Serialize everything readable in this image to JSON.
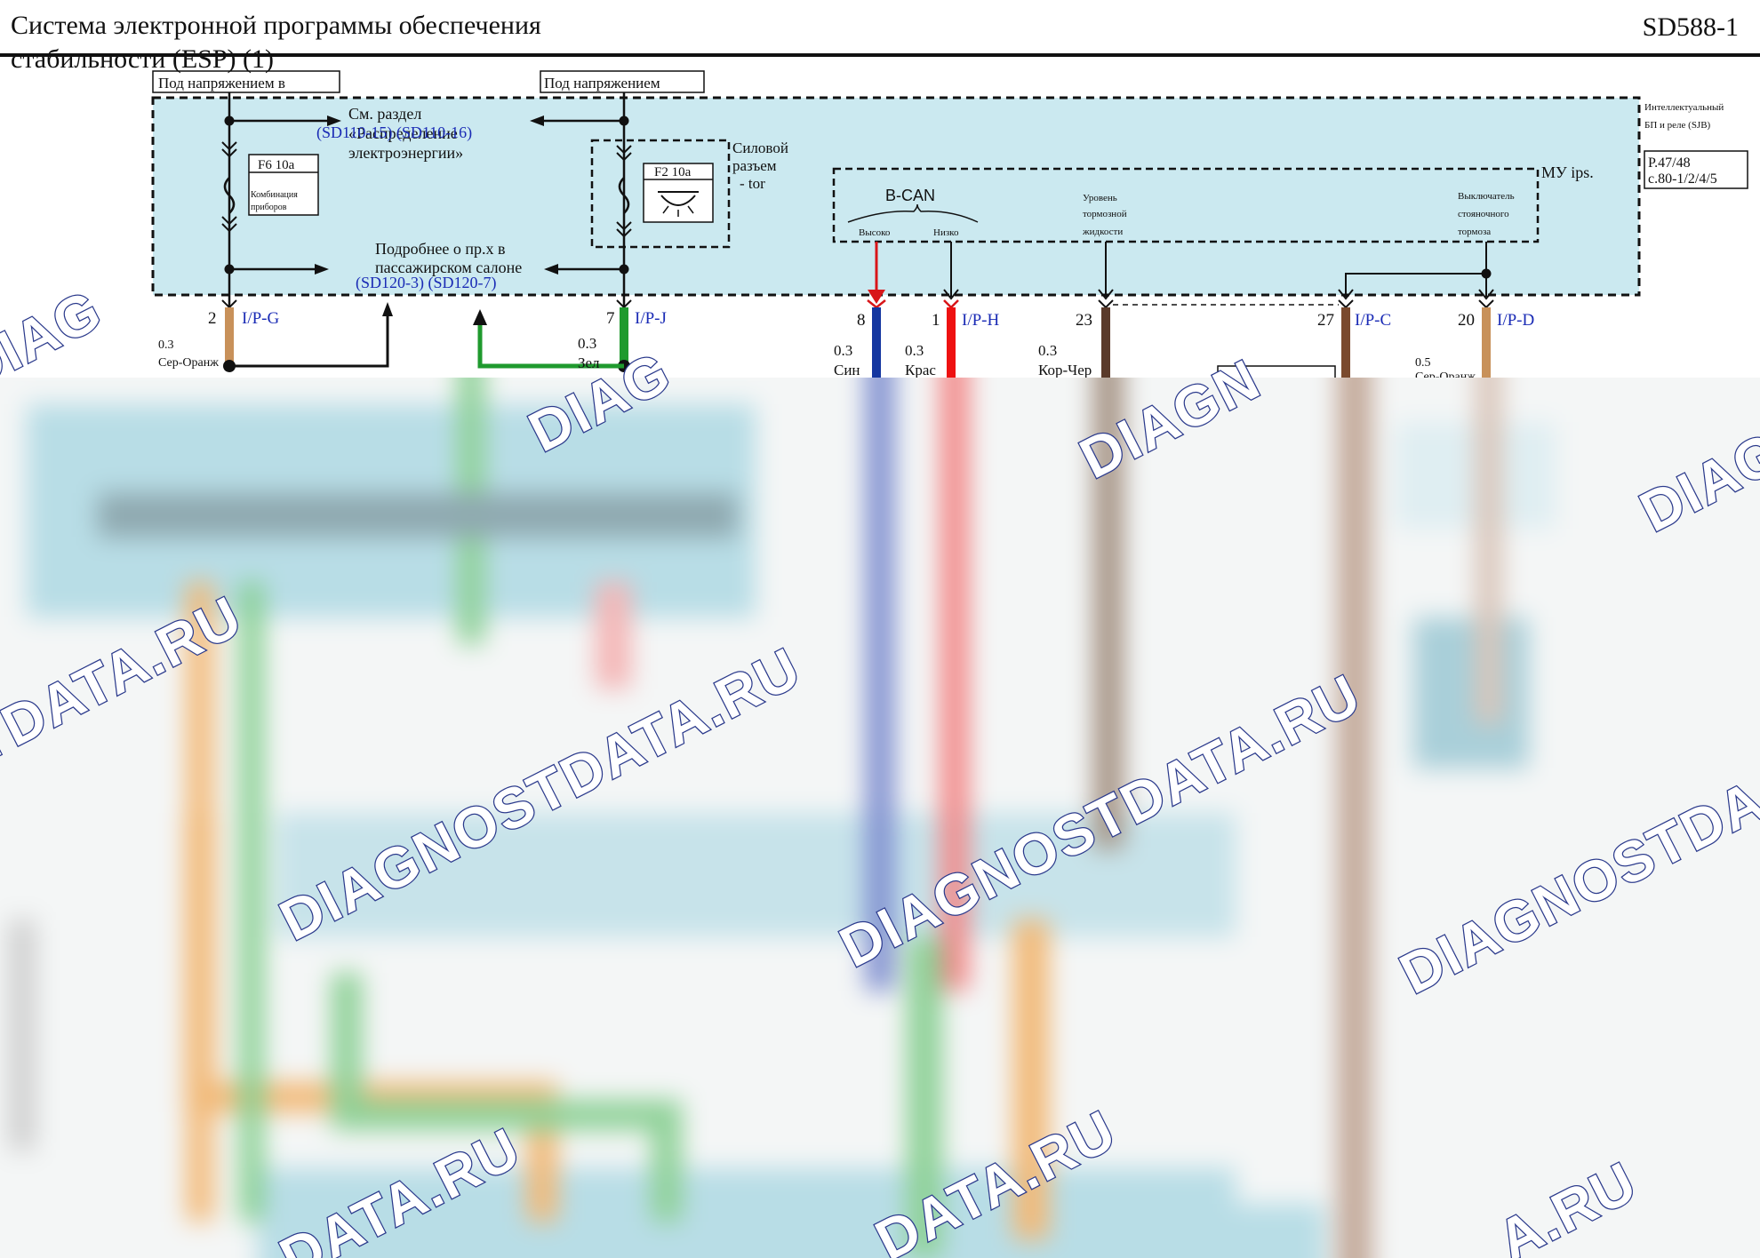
{
  "header": {
    "title_line1": "Система электронной программы обеспечения",
    "title_line2": "стабильности (ESP) (1)",
    "page_id": "SD588-1"
  },
  "labels": {
    "hot_in_left": "Под напряжением в",
    "hot_in_right": "Под напряжением",
    "see_section": "См. раздел",
    "ref_sd110": "(SD110-15) (SD110-16)",
    "power_distribution": "«Распределение",
    "power_distribution2": "электроэнергии»",
    "fuse_f6": "F6 10a",
    "fuse_f6_desc1": "Комбинация",
    "fuse_f6_desc2": "приборов",
    "fuse_f2": "F2 10a",
    "power_conn1": "Силовой",
    "power_conn2": "разъем",
    "power_conn3": "- tor",
    "details1": "Подробнее о пр.х в",
    "details2": "пассажирском салоне",
    "ref_sd120": "(SD120-3) (SD120-7)",
    "sjb1": "Интеллектуальный",
    "sjb2": "БП и реле (SJB)",
    "ref_p1": "P.47/48",
    "ref_p2": "с.80-1/2/4/5",
    "mu_ips": "МУ ips.",
    "bcan": "B-CAN",
    "high": "Высоко",
    "low": "Низко",
    "brake_fluid1": "Уровень",
    "brake_fluid2": "тормозной",
    "brake_fluid3": "жидкости",
    "parking1": "Выключатель",
    "parking2": "стояночного",
    "parking3": "тормоза"
  },
  "pins": [
    {
      "num": "2",
      "conn": "I/P-G",
      "gauge": "0.3",
      "color_name": "Сер-Оранж",
      "wire_color": "#c8915a"
    },
    {
      "num": "7",
      "conn": "I/P-J",
      "gauge": "0.3",
      "color_name": "Зел",
      "wire_color": "#1f9a2e"
    },
    {
      "num": "8",
      "conn": "",
      "gauge": "0.3",
      "color_name": "Син",
      "wire_color": "#1436a0"
    },
    {
      "num": "1",
      "conn": "I/P-H",
      "gauge": "0.3",
      "color_name": "Крас",
      "wire_color": "#ee1111"
    },
    {
      "num": "23",
      "conn": "",
      "gauge": "0.3",
      "color_name": "Кор-Чер",
      "wire_color": "#5a3a2a"
    },
    {
      "num": "27",
      "conn": "I/P-C",
      "gauge": "",
      "color_name": "",
      "wire_color": "#7a4a2e"
    },
    {
      "num": "20",
      "conn": "I/P-D",
      "gauge": "0.5",
      "color_name": "Сер-Оранж",
      "wire_color": "#c8915a"
    }
  ],
  "watermark": {
    "text1": "DIAGNOSTDATA.RU",
    "text2": "DIAG",
    "text3": "DIAGN",
    "text4": "DIAGNOSTDA",
    "text5": "DATA.RU",
    "text6": "TDATA.RU",
    "text7": "A.RU"
  },
  "colors": {
    "sjb_fill": "#cbe9f0",
    "wm_stroke": "#2b3a8c",
    "ref_blue": "#1a2bb5"
  }
}
